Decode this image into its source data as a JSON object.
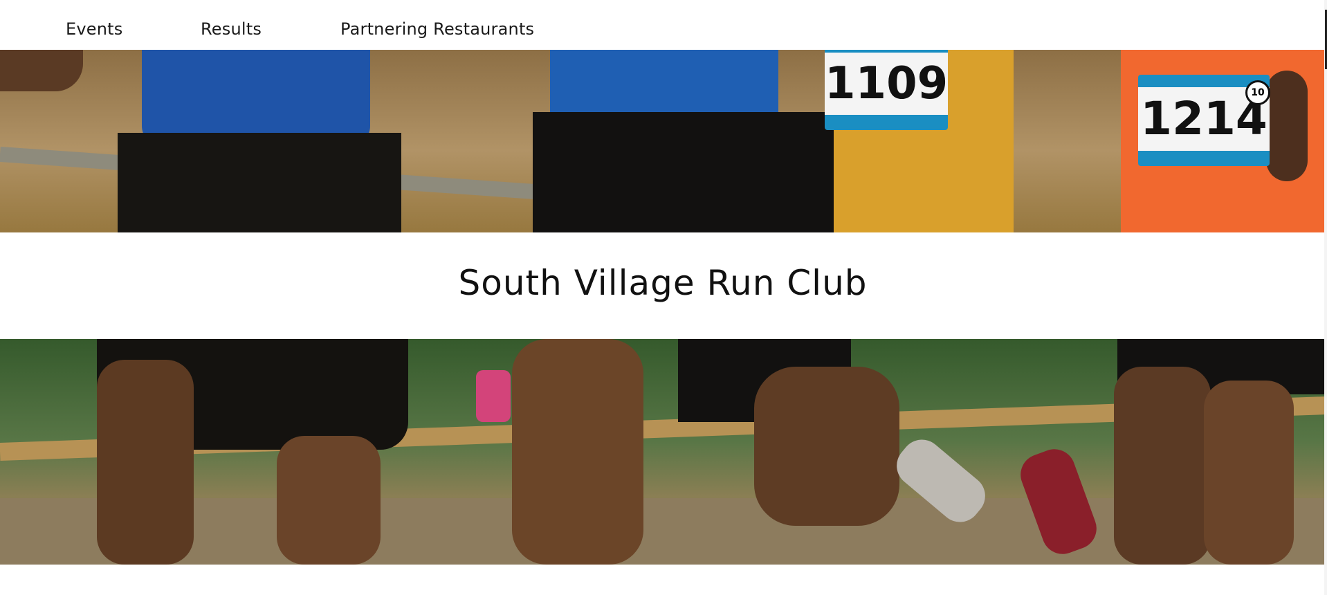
{
  "nav": {
    "events": "Events",
    "results": "Results",
    "restaurants": "Partnering Restaurants"
  },
  "hero": {
    "title": "South Village Run Club"
  },
  "bibs": {
    "left": "1109",
    "right": "1214",
    "badge": "10"
  },
  "colors": {
    "background": "#ffffff",
    "text": "#111111",
    "bib_accent": "#1a8ec2"
  }
}
